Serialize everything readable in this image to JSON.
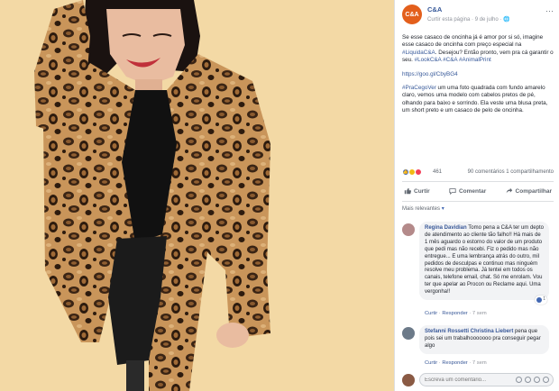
{
  "post": {
    "page_name": "C&A",
    "avatar_text": "C&A",
    "meta": "Curtir esta página · 9 de julho · 🌐",
    "more": "···",
    "paragraph1_a": "Se esse casaco de oncinha já é amor por si só, imagine esse casaco de oncinha com preço especial na ",
    "paragraph1_link1": "#LiquidaC&A",
    "paragraph1_b": ". Desejou? Então pronto, vem pra cá garantir o seu. ",
    "paragraph1_link2": "#LookC&A #C&A #AnimalPrint",
    "link": "https://goo.gl/CbyBG4",
    "paragraph3_link": "#PraCegoVer",
    "paragraph3": " um uma foto quadrada com fundo amarelo claro, vemos uma modelo com cabelos pretos de pé, olhando para baixo e sorrindo. Ela veste uma blusa preta, um short preto e um casaco de pelo de oncinha."
  },
  "reactions": {
    "count": "461",
    "meta": "90 comentários  1 compartilhamento"
  },
  "actions": {
    "like": "Curtir",
    "comment": "Comentar",
    "share": "Compartilhar"
  },
  "relevance": {
    "label": "Mais relevantes",
    "chevron": "▾"
  },
  "comments": [
    {
      "author": "Regina Davidian",
      "text": " Tomo pena a C&A ter um depto de atendimento ao cliente tão falho!! Há mais de 1 mês aguardo o estorno do valor de um produto que pedi mas não recebi. Fiz o pedido mas não entregue... E uma lembrança atrás do outro, mil pedidos de desculpas e continuo mas ninguém resolve meu problema. Já tentei em todos os canais, telefone email, chat. Só me enrolam. Vou ter que apelar ao Procon ou Reclame aqui. Uma vergonha!!",
      "like": "Curtir",
      "reply": "Responder",
      "time": "7 sem",
      "badge": "1"
    },
    {
      "author": "Stefanni Rossetti Christina Liebert",
      "text": " pena que pois sei um trabalhooooooo pra conseguir pegar algo",
      "like": "Curtir",
      "reply": "Responder",
      "time": "7 sem"
    }
  ],
  "composer": {
    "placeholder": "Escreva um comentário..."
  },
  "colors": {
    "background": "#f3d9a5",
    "link": "#365899",
    "brand": "#e35f1c"
  }
}
